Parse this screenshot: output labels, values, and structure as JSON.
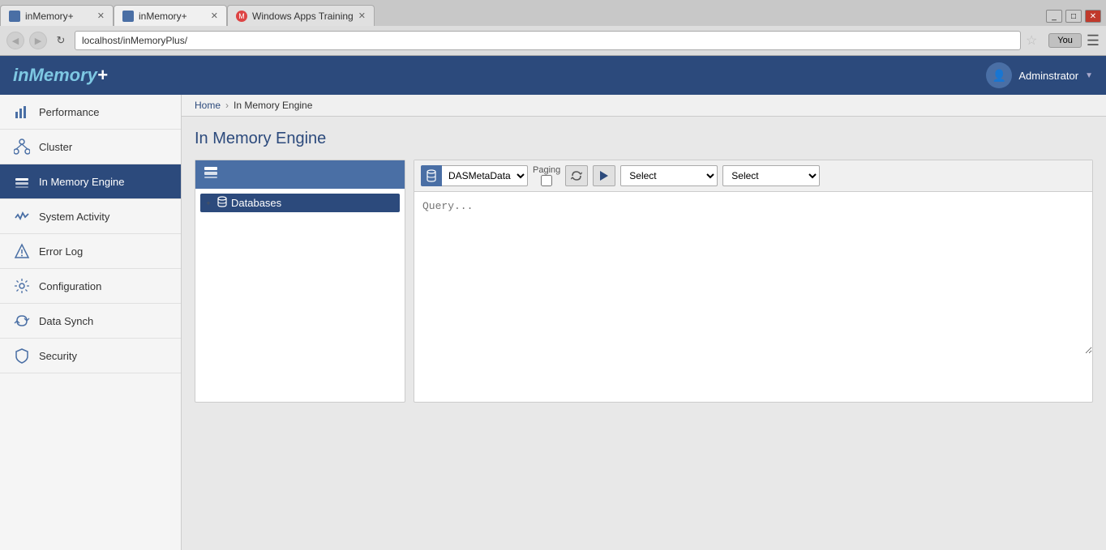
{
  "browser": {
    "tabs": [
      {
        "id": "tab1",
        "label": "inMemory+",
        "active": false,
        "favicon": "blue"
      },
      {
        "id": "tab2",
        "label": "inMemory+",
        "active": true,
        "favicon": "blue"
      },
      {
        "id": "tab3",
        "label": "Windows Apps Training",
        "active": false,
        "favicon": "gmail"
      }
    ],
    "address": "localhost/inMemoryPlus/",
    "user_btn": "You",
    "window_controls": [
      "_",
      "□",
      "✕"
    ]
  },
  "app": {
    "logo": "inMemory+",
    "user_name": "Adminstrator",
    "user_icon": "👤"
  },
  "breadcrumb": {
    "home": "Home",
    "current": "In Memory Engine"
  },
  "page": {
    "title": "In Memory Engine"
  },
  "sidebar": {
    "items": [
      {
        "id": "performance",
        "label": "Performance",
        "icon": "📊",
        "active": false
      },
      {
        "id": "cluster",
        "label": "Cluster",
        "icon": "🔗",
        "active": false
      },
      {
        "id": "in-memory-engine",
        "label": "In Memory Engine",
        "icon": "⚙",
        "active": true
      },
      {
        "id": "system-activity",
        "label": "System Activity",
        "icon": "📈",
        "active": false
      },
      {
        "id": "error-log",
        "label": "Error Log",
        "icon": "⚠",
        "active": false
      },
      {
        "id": "configuration",
        "label": "Configuration",
        "icon": "⚙",
        "active": false
      },
      {
        "id": "data-synch",
        "label": "Data Synch",
        "icon": "🔄",
        "active": false
      },
      {
        "id": "security",
        "label": "Security",
        "icon": "🔒",
        "active": false
      }
    ]
  },
  "tree_panel": {
    "items": [
      {
        "id": "databases",
        "label": "Databases",
        "expanded": false,
        "selected": true
      }
    ]
  },
  "query_panel": {
    "db_options": [
      "DASMetaData"
    ],
    "db_selected": "DASMetaData",
    "paging_label": "Paging",
    "select1_options": [
      "Select"
    ],
    "select1_value": "Select",
    "select2_options": [
      "Select"
    ],
    "select2_value": "Select",
    "query_placeholder": "Query..."
  }
}
